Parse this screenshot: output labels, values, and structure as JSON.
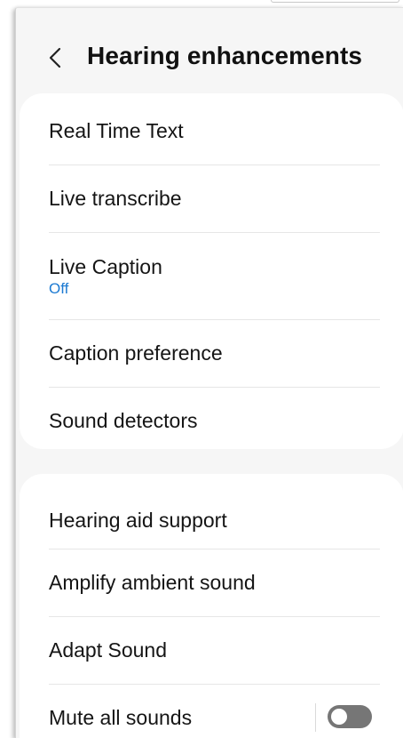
{
  "header": {
    "back_icon": "chevron-left-icon",
    "title": "Hearing enhancements"
  },
  "group1": {
    "items": [
      {
        "label": "Real Time Text"
      },
      {
        "label": "Live transcribe"
      },
      {
        "label": "Live Caption",
        "sub": "Off"
      },
      {
        "label": "Caption preference"
      },
      {
        "label": "Sound detectors"
      }
    ]
  },
  "group2": {
    "items": [
      {
        "label": "Hearing aid support"
      },
      {
        "label": "Amplify ambient sound"
      },
      {
        "label": "Adapt Sound"
      },
      {
        "label": "Mute all sounds",
        "toggle_state": "off"
      }
    ]
  },
  "colors": {
    "accent_sub_text": "#1c7ad2",
    "toggle_off": "#767676",
    "background": "#f6f6f6",
    "card": "#ffffff"
  }
}
